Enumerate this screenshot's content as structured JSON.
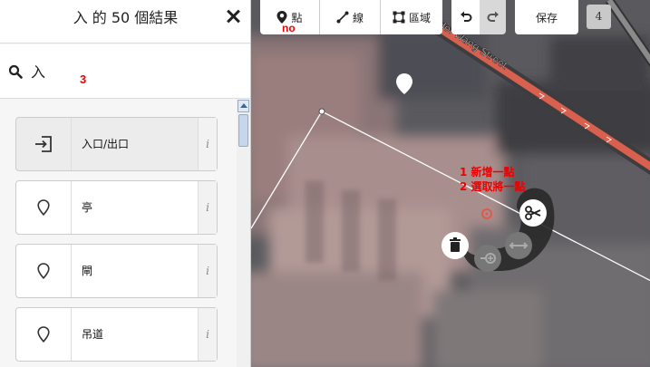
{
  "sidebar": {
    "title": "入 的 50 個結果",
    "search": {
      "value": "入",
      "placeholder": ""
    },
    "results": [
      {
        "label": "入口/出口",
        "icon": "entrance-icon",
        "info": "i"
      },
      {
        "label": "亭",
        "icon": "marker-icon",
        "info": "i"
      },
      {
        "label": "閘",
        "icon": "marker-icon",
        "info": "i"
      },
      {
        "label": "吊道",
        "icon": "marker-icon",
        "info": "i"
      }
    ]
  },
  "toolbar": {
    "point_label": "點",
    "line_label": "線",
    "area_label": "區域",
    "save_label": "保存",
    "edit_count": "4"
  },
  "annotations": {
    "search_marker": "3",
    "point_marker": "no",
    "vertex_note_line1": "1 新增一點",
    "vertex_note_line2": "2 選取將一點"
  },
  "map": {
    "street_label": "Hoi Wang Street"
  },
  "colors": {
    "road": "#e06050",
    "polygon_stroke": "#ffffff",
    "annotation": "#ee0000"
  }
}
